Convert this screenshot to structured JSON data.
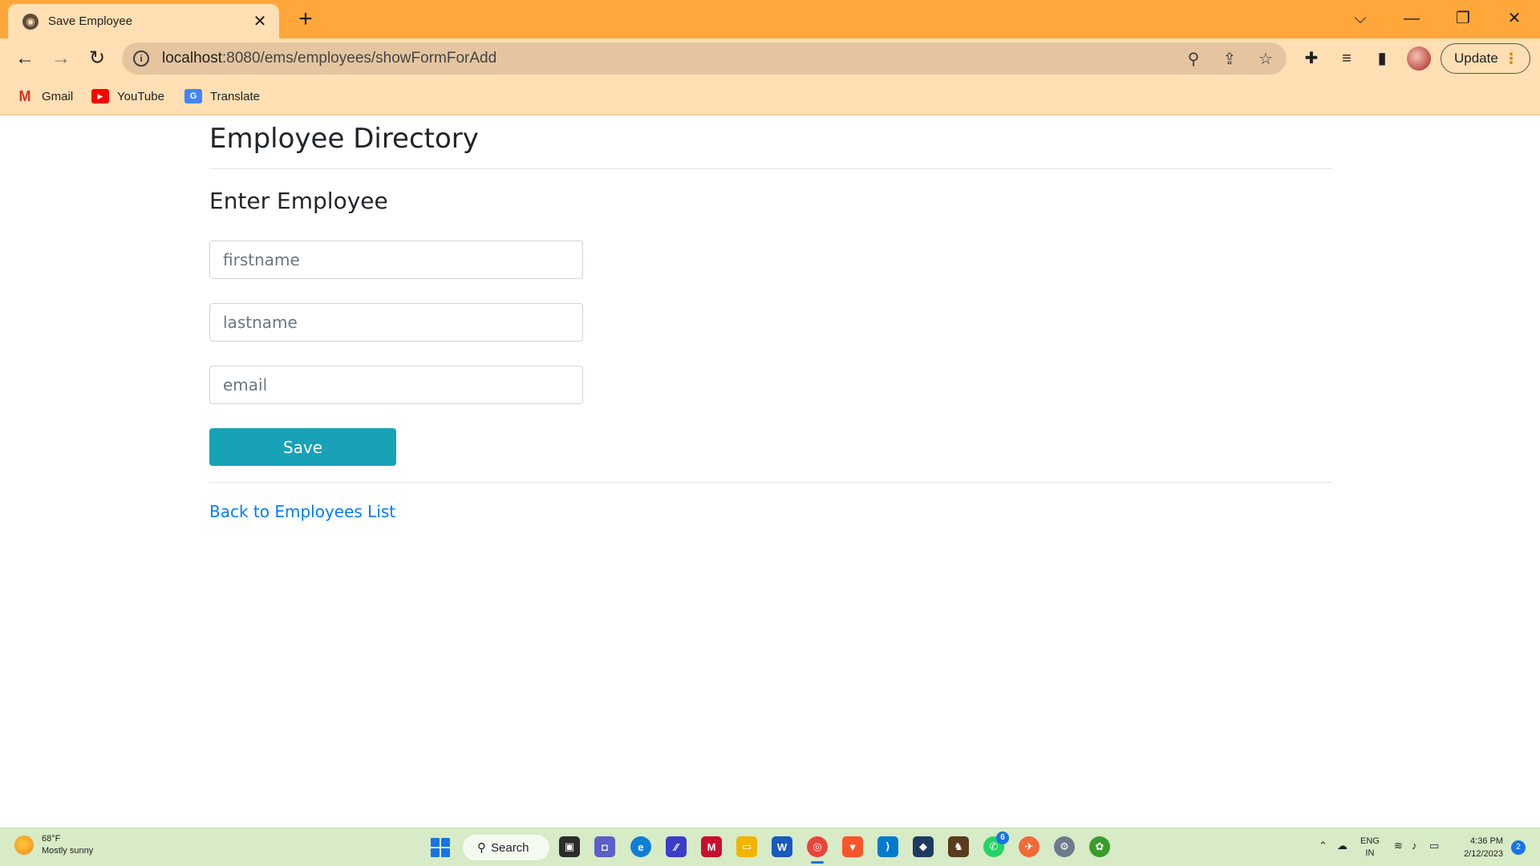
{
  "browser": {
    "tab_title": "Save Employee",
    "tab_close": "✕",
    "new_tab": "+",
    "window_controls": {
      "dropdown": "⌵",
      "minimize": "—",
      "restore": "❐",
      "close": "✕"
    },
    "url_host": "localhost",
    "url_path": ":8080/ems/employees/showFormForAdd",
    "update_label": "Update",
    "bookmarks": [
      {
        "label": "Gmail",
        "icon": "gmail-icon"
      },
      {
        "label": "YouTube",
        "icon": "youtube-icon"
      },
      {
        "label": "Translate",
        "icon": "translate-icon"
      }
    ]
  },
  "page": {
    "title": "Employee Directory",
    "subtitle": "Enter Employee",
    "fields": {
      "firstname_placeholder": "firstname",
      "lastname_placeholder": "lastname",
      "email_placeholder": "email"
    },
    "save_label": "Save",
    "back_link": "Back to Employees List"
  },
  "taskbar": {
    "weather_temp": "68°F",
    "weather_desc": "Mostly sunny",
    "search_label": "Search",
    "language_top": "ENG",
    "language_bottom": "IN",
    "time": "4:36 PM",
    "date": "2/12/2023",
    "notification_count": "2",
    "whatsapp_badge": "6"
  },
  "colors": {
    "tabstrip": "#ffa73a",
    "toolbar": "#ffdfb3",
    "save_button": "#17a2b8",
    "link": "#007bff",
    "taskbar": "#d6ebc6"
  }
}
